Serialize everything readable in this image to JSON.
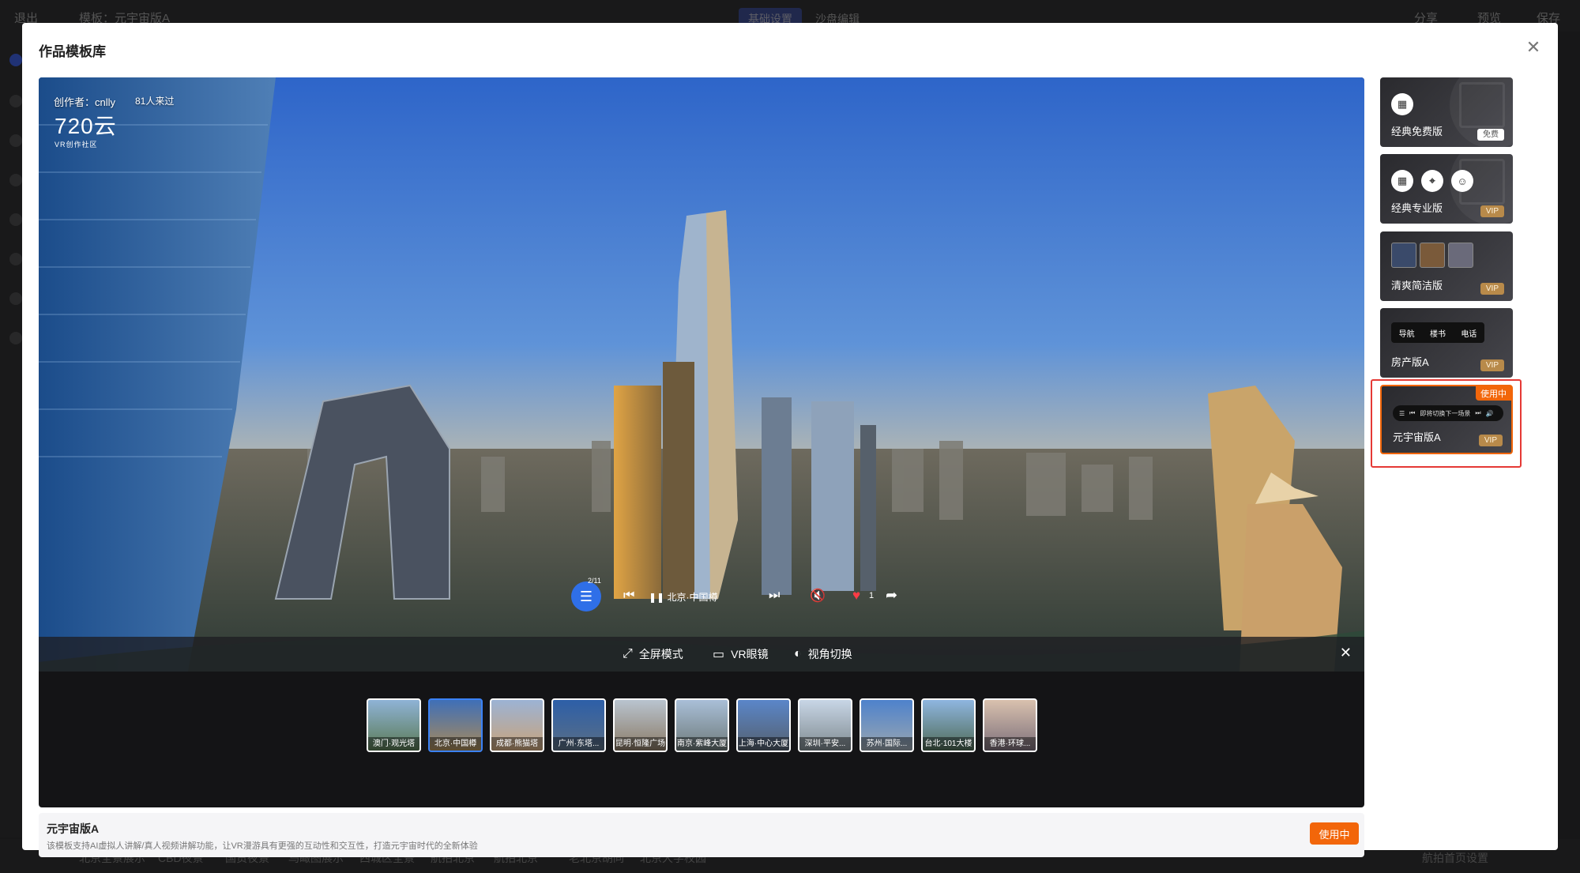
{
  "background": {
    "exit_label": "退出",
    "template_label": "模板：元宇宙版A",
    "tab_basic": "基础设置",
    "tab_scene": "沙盘编辑",
    "share_label": "分享",
    "preview_label": "预览",
    "save_label": "保存",
    "bottom_tabs": [
      "北京全景展示",
      "CBD夜景",
      "国贸夜景",
      "鸟瞰图展示",
      "西城区全景",
      "航拍北京",
      "航拍北京",
      "老北京胡同",
      "北京大学校园"
    ],
    "bottom_right": "航拍首页设置"
  },
  "modal": {
    "title": "作品模板库",
    "close_icon": "close-icon"
  },
  "preview": {
    "creator": "创作者：cnlly",
    "visitors": "81人来过",
    "logo_main": "720云",
    "logo_sub": "VR创作社区",
    "playlist_count": "2/11",
    "current_track": "北京·中国樽",
    "like_count": "1",
    "controls": {
      "fullscreen": "全屏模式",
      "vr": "VR眼镜",
      "view": "视角切换"
    },
    "thumbnails": [
      {
        "label": "澳门·观光塔",
        "active": false
      },
      {
        "label": "北京·中国樽",
        "active": true
      },
      {
        "label": "成都·熊猫塔",
        "active": false
      },
      {
        "label": "广州·东塔...",
        "active": false
      },
      {
        "label": "昆明·恒隆广场",
        "active": false
      },
      {
        "label": "南京·紫峰大厦",
        "active": false
      },
      {
        "label": "上海·中心大厦",
        "active": false
      },
      {
        "label": "深圳·平安...",
        "active": false
      },
      {
        "label": "苏州·国际...",
        "active": false
      },
      {
        "label": "台北·101大楼",
        "active": false
      },
      {
        "label": "香港·环球...",
        "active": false
      }
    ]
  },
  "info": {
    "name": "元宇宙版A",
    "description": "该模板支持AI虚拟人讲解/真人视频讲解功能，让VR漫游具有更强的互动性和交互性，打造元宇宙时代的全新体验",
    "status_button": "使用中"
  },
  "templates": [
    {
      "name": "经典免费版",
      "badge": "免费",
      "badge_type": "free"
    },
    {
      "name": "经典专业版",
      "badge": "VIP",
      "badge_type": "vip"
    },
    {
      "name": "清爽简洁版",
      "badge": "VIP",
      "badge_type": "vip"
    },
    {
      "name": "房产版A",
      "badge": "VIP",
      "badge_type": "vip",
      "nav": [
        "导航",
        "楼书",
        "电话"
      ]
    },
    {
      "name": "元宇宙版A",
      "badge": "VIP",
      "badge_type": "vip",
      "tag": "使用中",
      "player_text": "即将切换下一场景"
    }
  ],
  "colors": {
    "accent": "#f2660a",
    "selected_border": "#e53935",
    "playlist_button": "#2f6fe8"
  }
}
